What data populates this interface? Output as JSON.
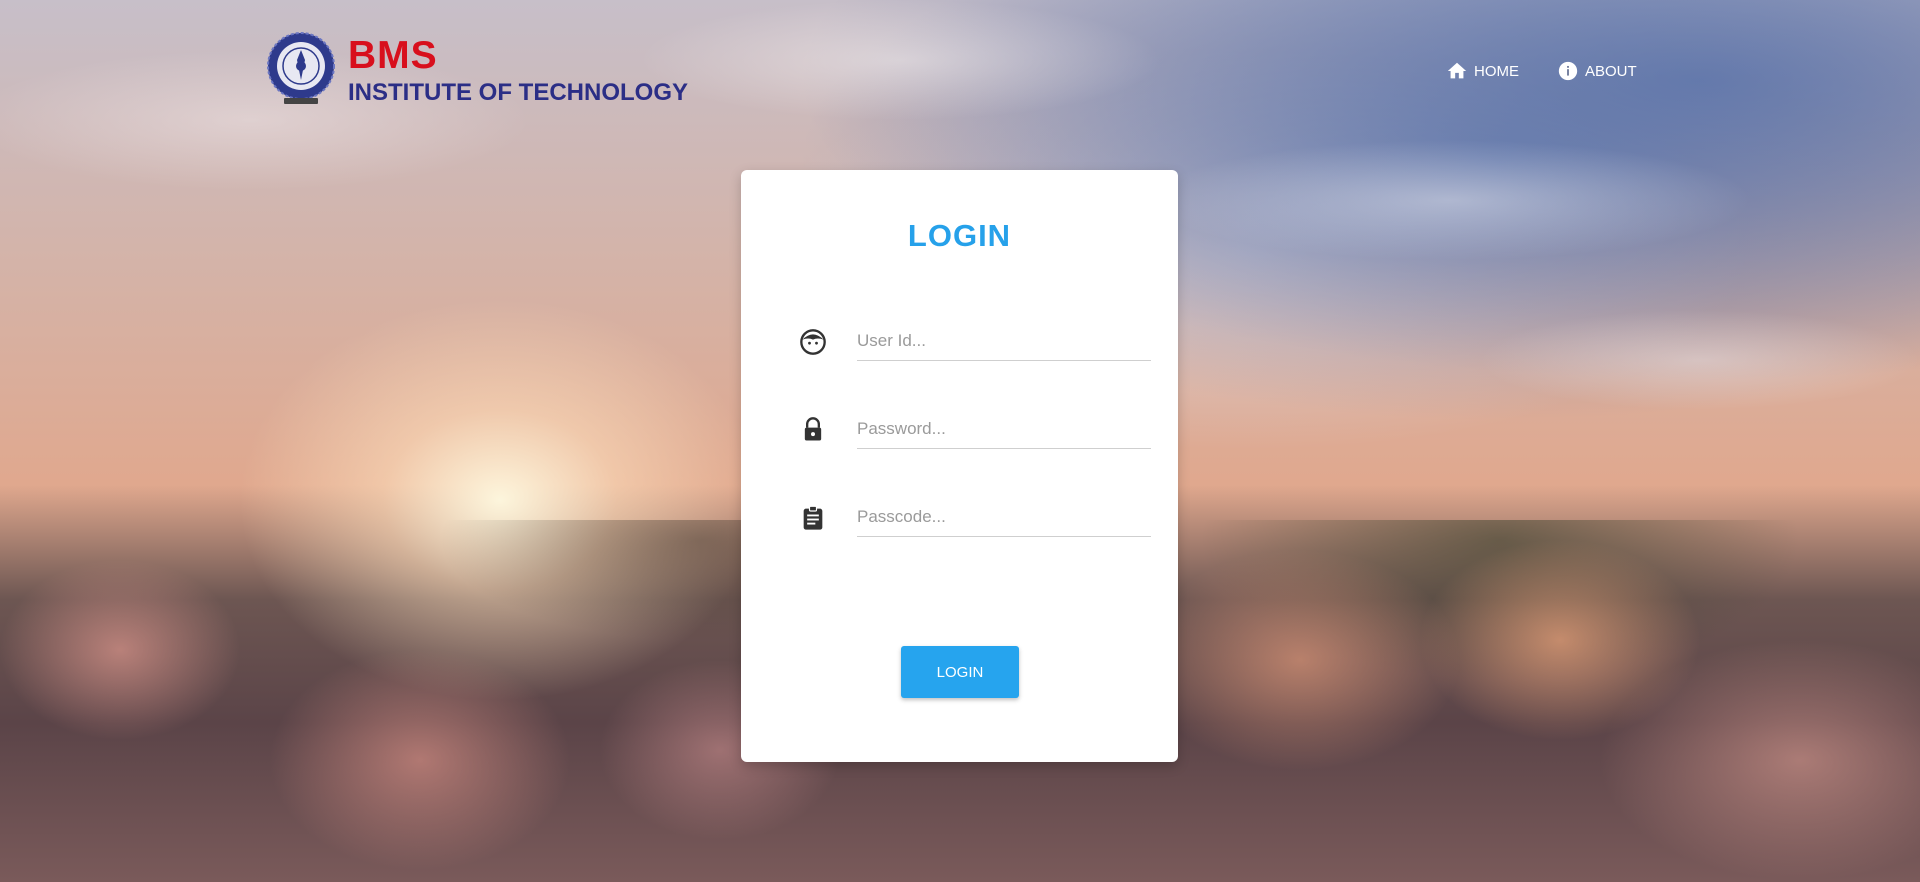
{
  "brand": {
    "name": "BMS",
    "subtitle": "INSTITUTE OF TECHNOLOGY"
  },
  "nav": {
    "items": [
      {
        "label": "HOME",
        "icon": "home-icon"
      },
      {
        "label": "ABOUT",
        "icon": "info-icon"
      }
    ]
  },
  "login": {
    "title": "LOGIN",
    "fields": [
      {
        "placeholder": "User Id...",
        "value": "",
        "icon": "user-face-icon"
      },
      {
        "placeholder": "Password...",
        "value": "",
        "icon": "lock-icon"
      },
      {
        "placeholder": "Passcode...",
        "value": "",
        "icon": "clipboard-icon"
      }
    ],
    "button_label": "LOGIN"
  },
  "colors": {
    "accent": "#26a4ee",
    "brand_red": "#d80f1d",
    "brand_blue": "#2b2e86"
  }
}
